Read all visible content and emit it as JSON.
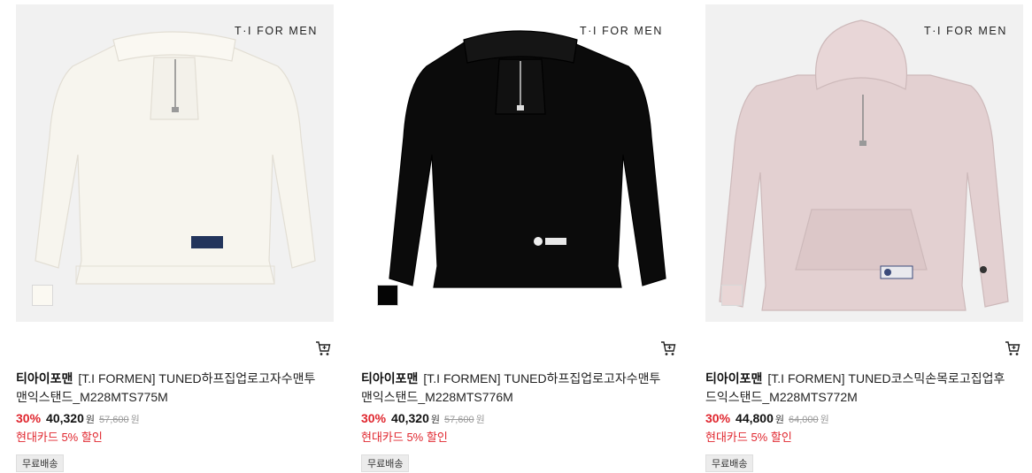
{
  "products": [
    {
      "brand_logo_text": "T·I FOR MEN",
      "swatch_color": "#fbf9f2",
      "garment_color": "#f7f5ee",
      "brand": "티아이포맨",
      "name": "[T.I FORMEN] TUNED하프집업로고자수맨투맨익스탠드_M228MTS775M",
      "discount_rate": "30%",
      "sale_price": "40,320",
      "sale_unit": "원",
      "original_price": "57,600",
      "original_unit": "원",
      "promo": "현대카드 5% 할인",
      "tag": "무료배송",
      "cart_icon": "cart-icon"
    },
    {
      "brand_logo_text": "T·I FOR MEN",
      "swatch_color": "#050505",
      "garment_color": "#0b0b0b",
      "brand": "티아이포맨",
      "name": "[T.I FORMEN] TUNED하프집업로고자수맨투맨익스탠드_M228MTS776M",
      "discount_rate": "30%",
      "sale_price": "40,320",
      "sale_unit": "원",
      "original_price": "57,600",
      "original_unit": "원",
      "promo": "현대카드 5% 할인",
      "tag": "무료배송",
      "cart_icon": "cart-icon"
    },
    {
      "brand_logo_text": "T·I FOR MEN",
      "swatch_color": "#e9d6d6",
      "garment_color": "#e3d0d1",
      "brand": "티아이포맨",
      "name": "[T.I FORMEN] TUNED코스믹손목로고집업후드익스탠드_M228MTS772M",
      "discount_rate": "30%",
      "sale_price": "44,800",
      "sale_unit": "원",
      "original_price": "64,000",
      "original_unit": "원",
      "promo": "현대카드 5% 할인",
      "tag": "무료배송",
      "cart_icon": "cart-icon"
    }
  ],
  "colors": {
    "discount_red": "#e0262e",
    "image_bg": "#f1f1f1"
  }
}
